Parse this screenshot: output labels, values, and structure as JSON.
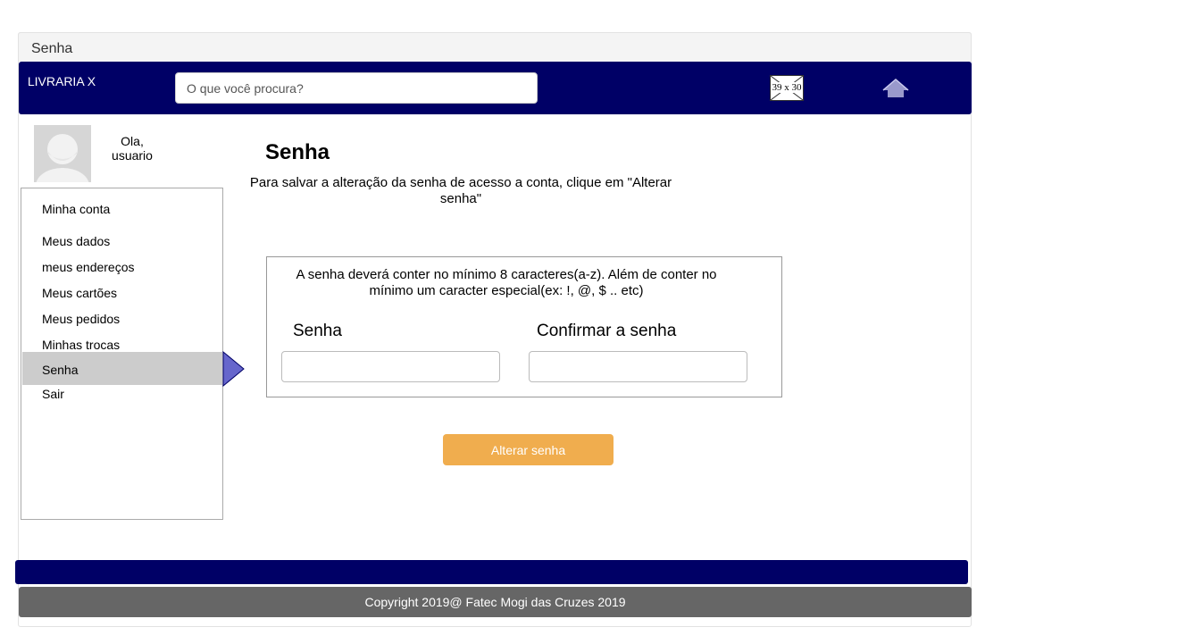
{
  "window": {
    "title": "Senha"
  },
  "header": {
    "logo": "LIVRARIA X",
    "search_placeholder": "O que você procura?",
    "image_placeholder": "39 x 30",
    "home_icon": "home-icon",
    "bar_color": "#000066"
  },
  "user": {
    "greeting": "Ola, usuario"
  },
  "sidebar": {
    "items": [
      {
        "label": "Minha conta"
      },
      {
        "label": "Meus dados"
      },
      {
        "label": "meus endereços"
      },
      {
        "label": "Meus cartões"
      },
      {
        "label": "Meus pedidos"
      },
      {
        "label": "Minhas trocas"
      },
      {
        "label": "Senha",
        "active": true
      },
      {
        "label": "Sair"
      }
    ],
    "active_color": "#cccccc",
    "indicator_color": "#6666cc"
  },
  "main": {
    "title": "Senha",
    "intro": "Para salvar a alteração da senha de acesso a conta, clique em \"Alterar senha\"",
    "rules": "A senha deverá conter no mínimo 8 caracteres(a-z). Além de conter no mínimo um caracter especial(ex: !, @, $ .. etc)",
    "password_label": "Senha",
    "password_value": "",
    "confirm_label": "Confirmar a senha",
    "confirm_value": "",
    "submit_label": "Alterar senha",
    "submit_color": "#f0ad4e"
  },
  "footer": {
    "copyright": "Copyright 2019@ Fatec Mogi das Cruzes 2019"
  }
}
